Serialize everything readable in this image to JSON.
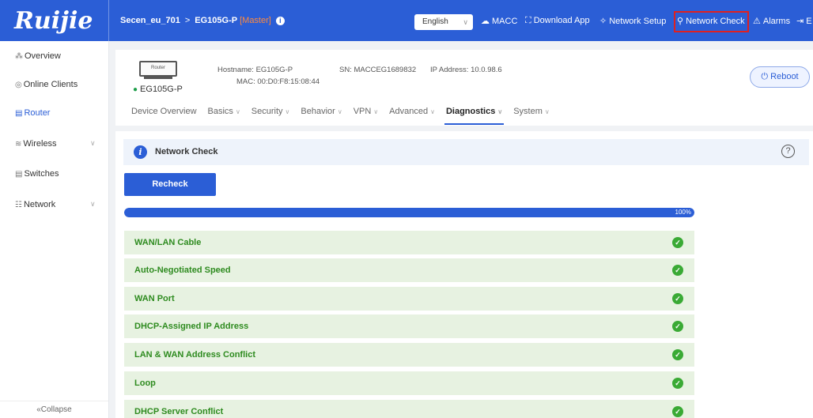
{
  "header": {
    "logo": "Ruijie",
    "breadcrumb": {
      "project": "Secen_eu_701",
      "separator": ">",
      "device": "EG105G-P",
      "role": "[Master]"
    },
    "language": "English",
    "actions": {
      "macc": "MACC",
      "download_app": "Download App",
      "network_setup": "Network Setup",
      "network_check": "Network Check",
      "alarms": "Alarms",
      "exit": "E"
    }
  },
  "sidebar": {
    "items": [
      {
        "label": "Overview",
        "icon": "overview-icon",
        "glyph": "⁂"
      },
      {
        "label": "Online Clients",
        "icon": "online-clients-icon",
        "glyph": "◎"
      },
      {
        "label": "Router",
        "icon": "router-icon",
        "glyph": "▤"
      },
      {
        "label": "Wireless",
        "icon": "wireless-icon",
        "glyph": "≋"
      },
      {
        "label": "Switches",
        "icon": "switches-icon",
        "glyph": "▤"
      },
      {
        "label": "Network",
        "icon": "network-icon",
        "glyph": "☷"
      }
    ],
    "collapse": "«Collapse"
  },
  "device": {
    "image_label": "Router",
    "name": "EG105G-P",
    "hostname_label": "Hostname:",
    "hostname": "EG105G-P",
    "sn_label": "SN:",
    "sn": "MACCEG1689832",
    "ip_label": "IP Address:",
    "ip": "10.0.98.6",
    "mac_label": "MAC:",
    "mac": "00:D0:F8:15:08:44",
    "reboot": "Reboot"
  },
  "tabs": [
    "Device Overview",
    "Basics",
    "Security",
    "Behavior",
    "VPN",
    "Advanced",
    "Diagnostics",
    "System"
  ],
  "panel": {
    "title": "Network Check",
    "recheck": "Recheck",
    "progress_label": "100%",
    "progress_value": 1.0,
    "checks": [
      "WAN/LAN Cable",
      "Auto-Negotiated Speed",
      "WAN Port",
      "DHCP-Assigned IP Address",
      "LAN & WAN Address Conflict",
      "Loop",
      "DHCP Server Conflict"
    ]
  },
  "colors": {
    "brand": "#2b5ed6",
    "success": "#3aaa35",
    "highlight": "#e02020"
  }
}
